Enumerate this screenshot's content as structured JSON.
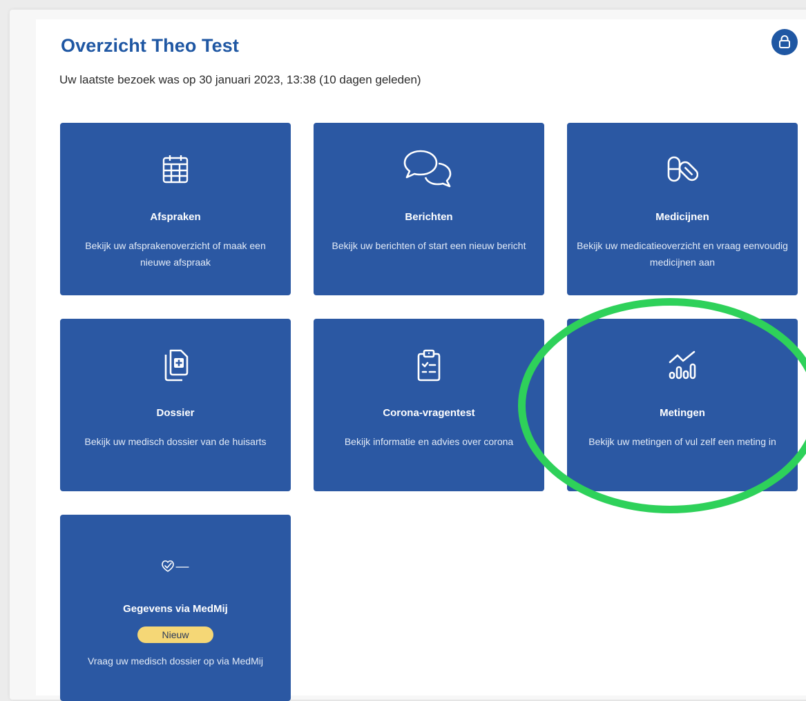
{
  "header": {
    "title": "Overzicht Theo Test",
    "subtitle": "Uw laatste bezoek was op 30 januari 2023, 13:38 (10 dagen geleden)",
    "lock_icon": "lock-icon"
  },
  "tiles": [
    {
      "icon": "calendar-icon",
      "title": "Afspraken",
      "description": "Bekijk uw afsprakenoverzicht of maak een nieuwe afspraak"
    },
    {
      "icon": "chat-bubbles-icon",
      "title": "Berichten",
      "description": "Bekijk uw berichten of start een nieuw bericht"
    },
    {
      "icon": "pills-icon",
      "title": "Medicijnen",
      "description": "Bekijk uw medicatieoverzicht en vraag eenvoudig medicijnen aan"
    },
    {
      "icon": "document-plus-icon",
      "title": "Dossier",
      "description": "Bekijk uw medisch dossier van de huisarts"
    },
    {
      "icon": "clipboard-checklist-icon",
      "title": "Corona-vragentest",
      "description": "Bekijk informatie en advies over corona"
    },
    {
      "icon": "measurements-chart-icon",
      "title": "Metingen",
      "description": "Bekijk uw metingen of vul zelf een meting in"
    },
    {
      "icon": "medmij-logo-icon",
      "title": "Gegevens via MedMij",
      "badge": "Nieuw",
      "description": "Vraag uw medisch dossier op via MedMij"
    }
  ],
  "colors": {
    "tile_background": "#2b58a3",
    "title_blue": "#1f57a3",
    "badge_yellow": "#f5d776",
    "highlight_green": "#2ed15a"
  }
}
